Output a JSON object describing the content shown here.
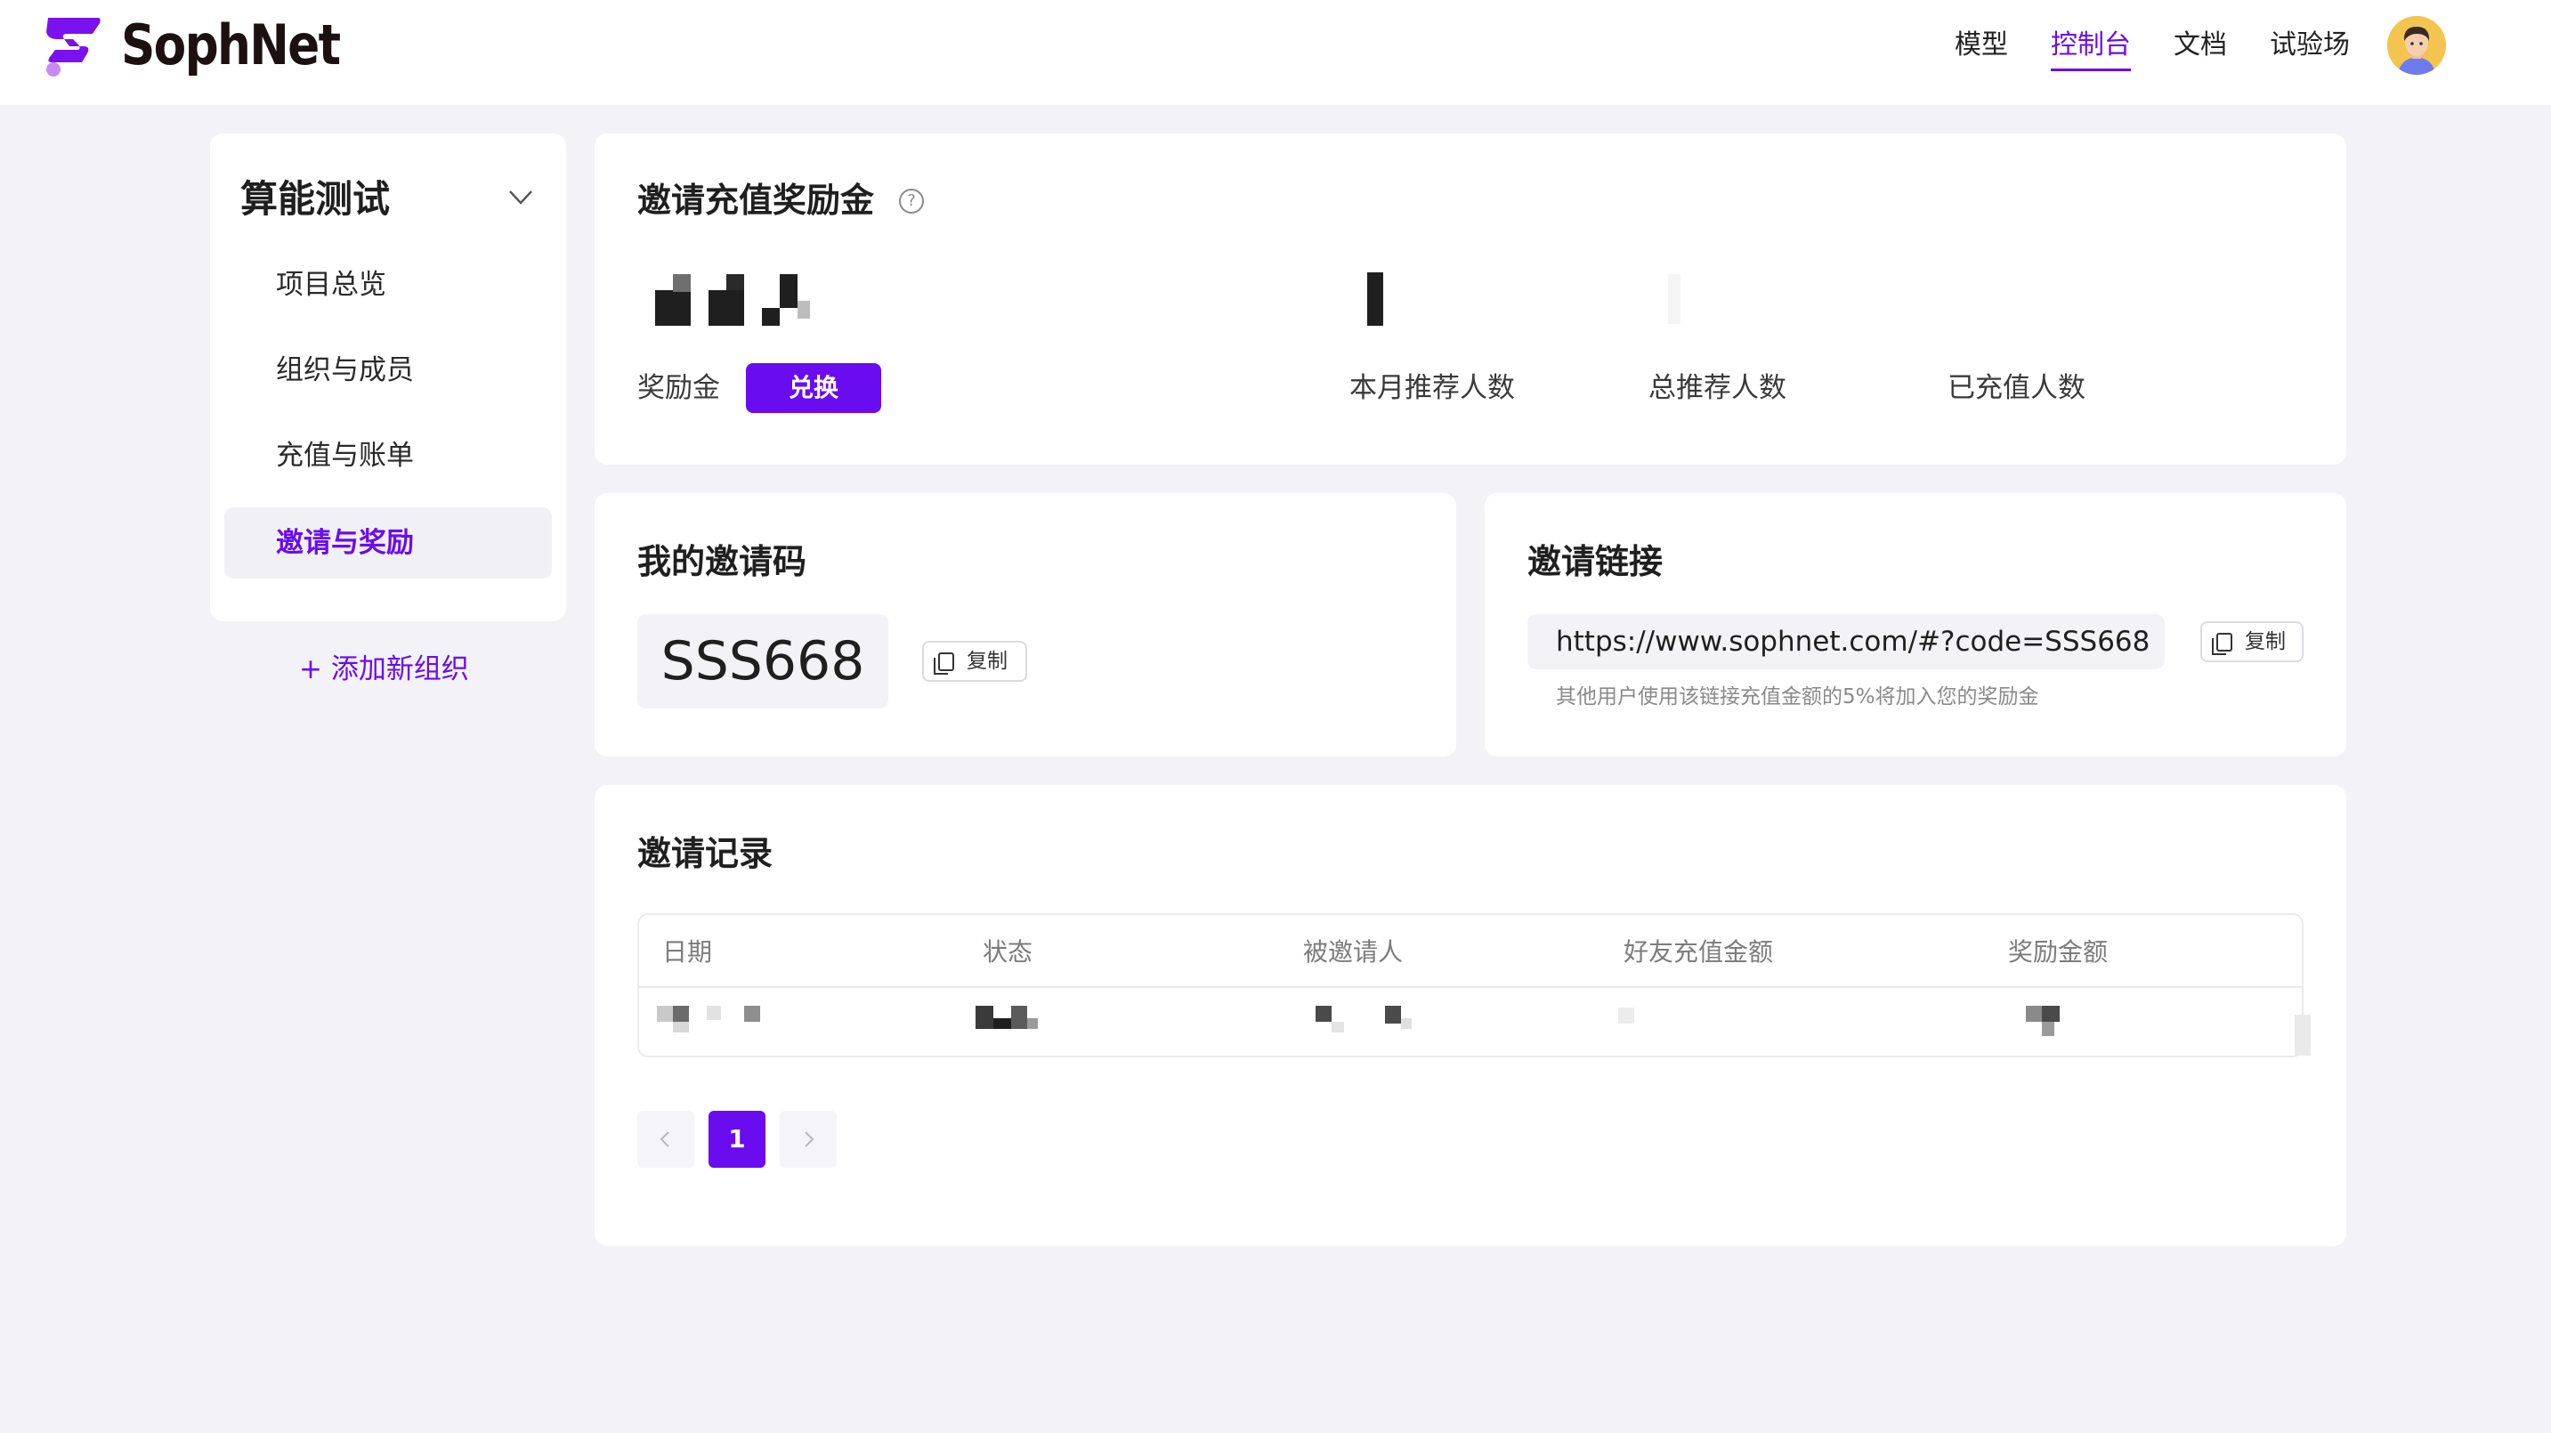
{
  "brand": {
    "name": "SophNet",
    "accent": "#6a0cf0"
  },
  "topnav": {
    "items": [
      "模型",
      "控制台",
      "文档",
      "试验场"
    ],
    "active_index": 1,
    "avatar_icon": "user-avatar-icon"
  },
  "sidebar": {
    "org_name": "算能测试",
    "items": [
      {
        "label": "项目总览"
      },
      {
        "label": "组织与成员"
      },
      {
        "label": "充值与账单"
      },
      {
        "label": "邀请与奖励",
        "active": true
      }
    ],
    "add_org_label": "+ 添加新组织"
  },
  "reward_card": {
    "title": "邀请充值奖励金",
    "bonus_label": "奖励金",
    "redeem_label": "兑换",
    "stats": [
      {
        "label": "本月推荐人数"
      },
      {
        "label": "总推荐人数"
      },
      {
        "label": "已充值人数"
      }
    ]
  },
  "invite_code_card": {
    "title": "我的邀请码",
    "code": "SSS668",
    "copy_label": "复制"
  },
  "invite_link_card": {
    "title": "邀请链接",
    "url": "https://www.sophnet.com/#?code=SSS668",
    "copy_label": "复制",
    "note": "其他用户使用该链接充值金额的5%将加入您的奖励金"
  },
  "records_card": {
    "title": "邀请记录",
    "columns": [
      "日期",
      "状态",
      "被邀请人",
      "好友充值金额",
      "奖励金额"
    ]
  },
  "pagination": {
    "current": "1",
    "prev_icon": "chevron-left-icon",
    "next_icon": "chevron-right-icon"
  }
}
